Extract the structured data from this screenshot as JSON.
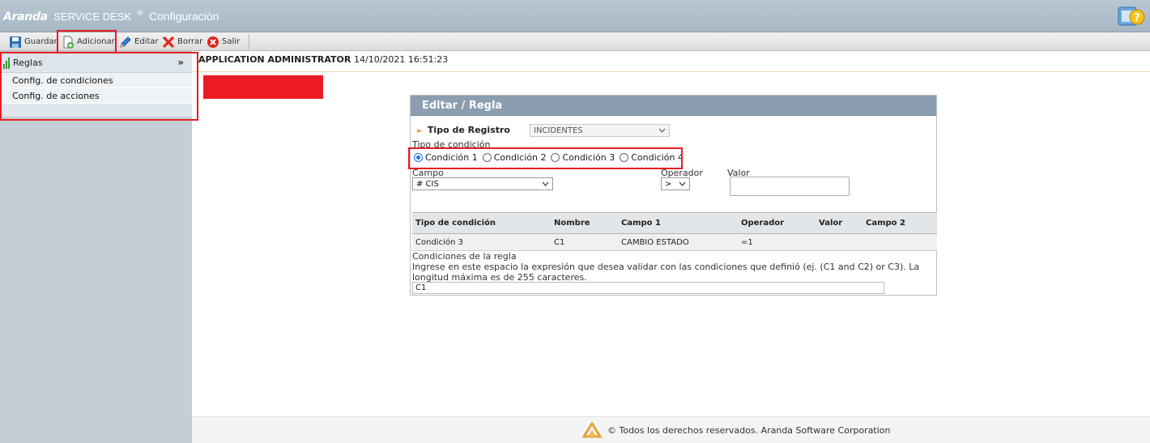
{
  "header": {
    "brand": "Aranda",
    "product": "SERVICE DESK",
    "registered": "®",
    "module": "Configuración",
    "help_icon": "help-question-icon"
  },
  "toolbar": {
    "guardar": "Guardar",
    "adicionar": "Adicionar",
    "editar": "Editar",
    "borrar": "Borrar",
    "salir": "Salir"
  },
  "sidebar": {
    "title": "Reglas",
    "items": [
      {
        "label": "Config. de condiciones"
      },
      {
        "label": "Config. de acciones"
      }
    ]
  },
  "user_bar": {
    "user": "APPLICATION ADMINISTRATOR",
    "datetime": "14/10/2021 16:51:23"
  },
  "panel": {
    "title": "Editar / Regla",
    "tipo_registro_label": "Tipo de Registro",
    "tipo_registro_value": "INCIDENTES",
    "tipo_condicion_label": "Tipo de condición",
    "radios": [
      {
        "label": "Condición 1",
        "checked": true
      },
      {
        "label": "Condición 2",
        "checked": false
      },
      {
        "label": "Condición 3",
        "checked": false
      },
      {
        "label": "Condición 4",
        "checked": false
      }
    ],
    "campo_label": "Campo",
    "campo_value": "# CIS",
    "operador_label": "Operador",
    "operador_value": ">",
    "valor_label": "Valor",
    "table": {
      "headers": [
        "Tipo de condición",
        "Nombre",
        "Campo 1",
        "Operador",
        "Valor",
        "Campo 2"
      ],
      "rows": [
        [
          "Condición 3",
          "C1",
          "CAMBIO ESTADO",
          "=1",
          "",
          ""
        ]
      ]
    },
    "condiciones_label": "Condiciones de la regla",
    "condiciones_help": "Ingrese en este espacio la expresión que desea validar con las condiciones que definió (ej. (C1 and C2) or C3). La longitud máxima es de 255 caracteres.",
    "condiciones_value": "C1"
  },
  "footer": {
    "text": "© Todos los derechos reservados. Aranda Software Corporation"
  },
  "colors": {
    "header_bg": "#a7b7c4",
    "panel_title_bg": "#8a9eb0",
    "highlight": "#e81c24",
    "sidebar_bg": "#c5ced6"
  }
}
